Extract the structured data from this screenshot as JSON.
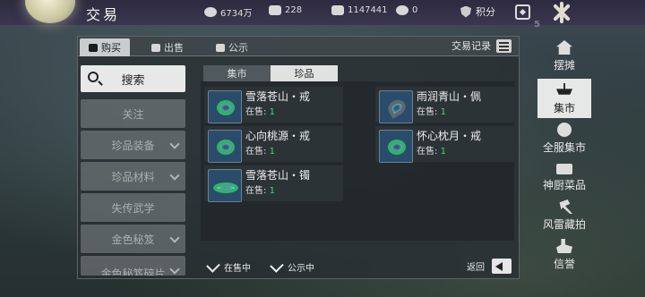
{
  "header": {
    "title": "交易",
    "resources": [
      {
        "icon": "coin-icon",
        "value": "6734万"
      },
      {
        "icon": "silver-icon",
        "value": "228"
      },
      {
        "icon": "ticket-icon",
        "value": "1147441"
      },
      {
        "icon": "bag-icon",
        "value": "0"
      }
    ],
    "points_label": "积分"
  },
  "tabs": [
    {
      "label": "购买",
      "active": true
    },
    {
      "label": "出售",
      "active": false
    },
    {
      "label": "公示",
      "active": false
    }
  ],
  "trade_record_label": "交易记录",
  "left_nav": {
    "search_label": "搜索",
    "items": [
      {
        "label": "关注",
        "has_chevron": false
      },
      {
        "label": "珍品装备",
        "has_chevron": true
      },
      {
        "label": "珍品材料",
        "has_chevron": true
      },
      {
        "label": "失传武学",
        "has_chevron": false
      },
      {
        "label": "金色秘笈",
        "has_chevron": true
      },
      {
        "label": "金色秘笈碎片",
        "has_chevron": true
      }
    ]
  },
  "sub_tabs": [
    {
      "label": "集市",
      "active": false
    },
    {
      "label": "珍品",
      "active": true
    }
  ],
  "goods": [
    {
      "name": "雪落苍山・戒",
      "sale_label": "在售:",
      "count": "1",
      "icon": "ring-icon"
    },
    {
      "name": "雨润青山・佩",
      "sale_label": "在售:",
      "count": "1",
      "icon": "pendant-icon"
    },
    {
      "name": "心向桃源・戒",
      "sale_label": "在售:",
      "count": "1",
      "icon": "ring-icon"
    },
    {
      "name": "怀心枕月・戒",
      "sale_label": "在售:",
      "count": "1",
      "icon": "ring-icon"
    },
    {
      "name": "雪落苍山・镯",
      "sale_label": "在售:",
      "count": "1",
      "icon": "bracelet-icon"
    }
  ],
  "filters": [
    {
      "label": "在售中",
      "checked": true
    },
    {
      "label": "公示中",
      "checked": true
    }
  ],
  "back_label": "返回",
  "right_sidebar": [
    {
      "label": "摆摊",
      "icon": "stall-icon",
      "active": false
    },
    {
      "label": "集市",
      "icon": "scale-icon",
      "active": true
    },
    {
      "label": "全服集市",
      "icon": "globe-icon",
      "active": false
    },
    {
      "label": "神厨菜品",
      "icon": "dish-icon",
      "active": false
    },
    {
      "label": "风雷藏拍",
      "icon": "hammer-icon",
      "active": false
    },
    {
      "label": "信誉",
      "icon": "hand-icon",
      "active": false
    }
  ]
}
